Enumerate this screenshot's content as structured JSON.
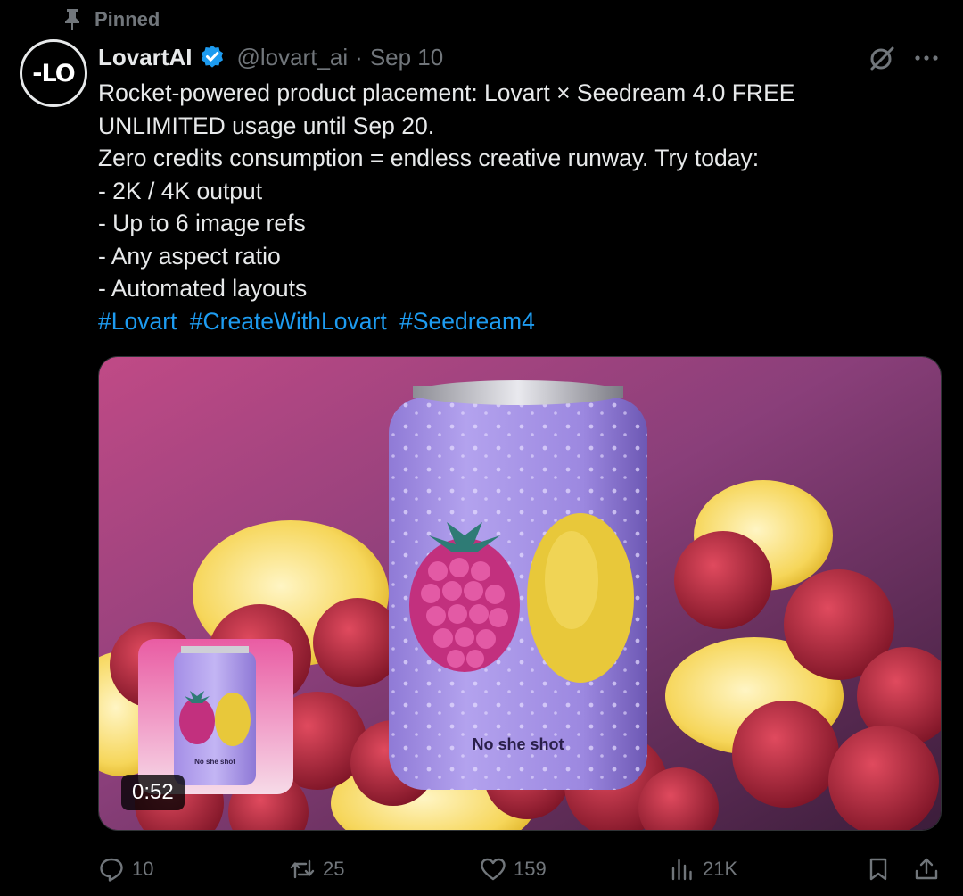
{
  "pinned": {
    "label": "Pinned",
    "icon": "pin-icon"
  },
  "author": {
    "avatar_text": "-LO",
    "name": "LovartAI",
    "verified_icon": "verified-badge-icon",
    "handle": "@lovart_ai",
    "separator": "·",
    "date": "Sep 10"
  },
  "body": {
    "lines": [
      "Rocket-powered product placement: Lovart × Seedream 4.0 FREE",
      "UNLIMITED usage until Sep 20.",
      "Zero credits consumption = endless creative runway. Try today:",
      "- 2K / 4K output",
      "- Up to 6 image refs",
      "- Any aspect ratio",
      "- Automated layouts"
    ],
    "hashtags": [
      "#Lovart",
      "#CreateWithLovart",
      "#Seedream4"
    ]
  },
  "media": {
    "type": "video",
    "duration": "0:52",
    "can_label": "No she shot",
    "pip_can_label": "No she shot"
  },
  "actions": {
    "reply": {
      "count": "10",
      "icon": "reply-icon"
    },
    "repost": {
      "count": "25",
      "icon": "repost-icon"
    },
    "like": {
      "count": "159",
      "icon": "heart-icon"
    },
    "views": {
      "count": "21K",
      "icon": "analytics-icon"
    },
    "bookmark": {
      "icon": "bookmark-icon"
    },
    "share": {
      "icon": "share-icon"
    }
  },
  "colors": {
    "background": "#000000",
    "text": "#e7e9ea",
    "muted": "#71767b",
    "accent": "#1d9bf0"
  }
}
